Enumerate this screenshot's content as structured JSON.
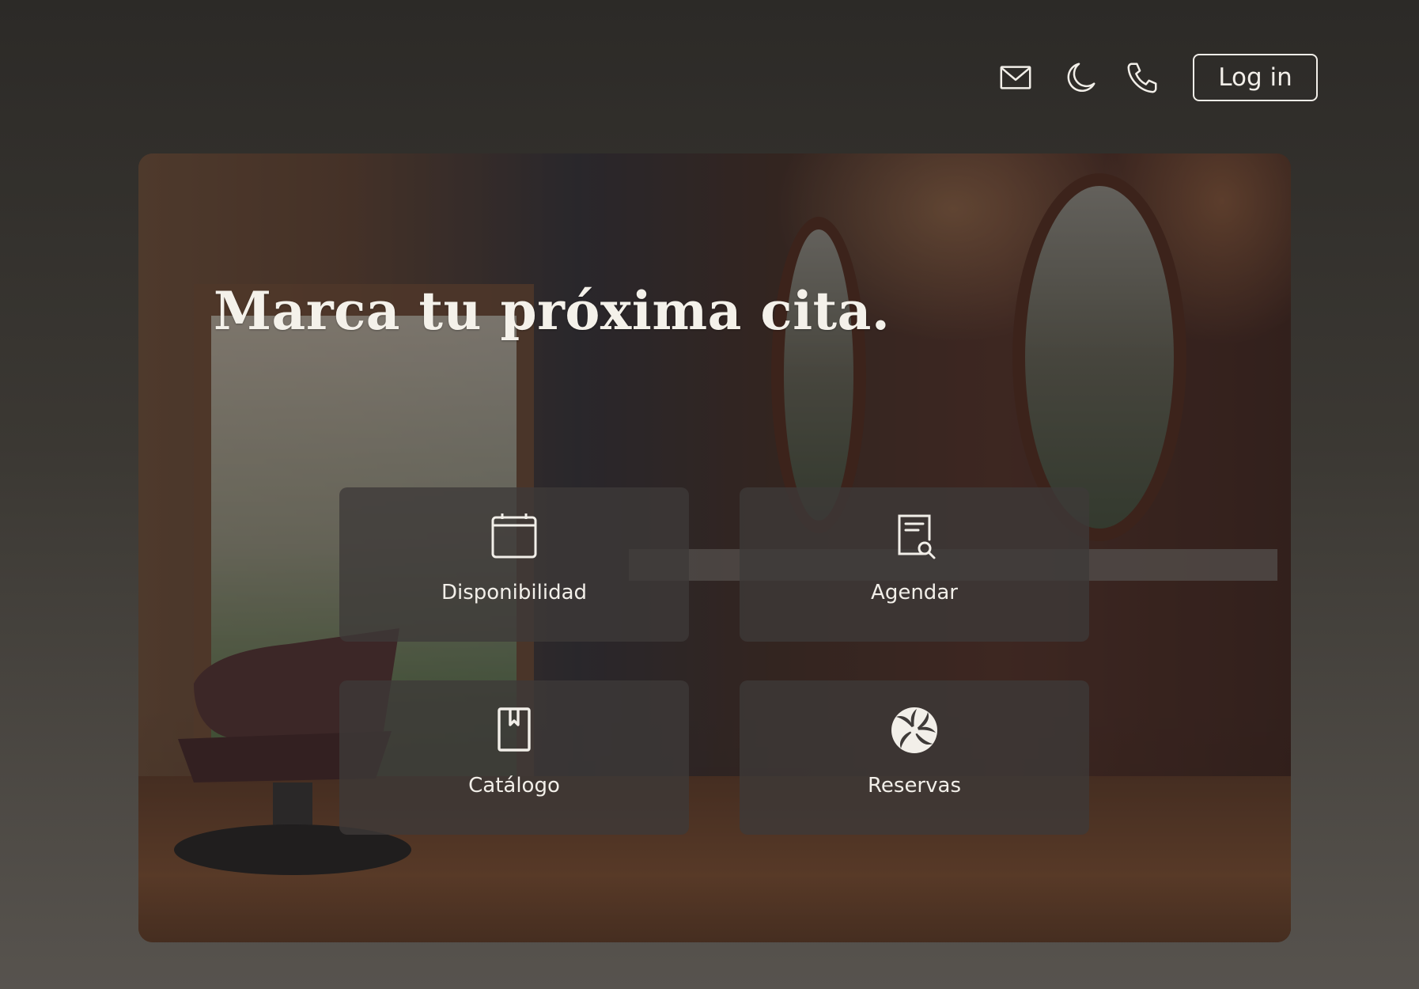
{
  "header": {
    "icons": [
      "mail-icon",
      "moon-icon",
      "phone-icon"
    ],
    "login_label": "Log in"
  },
  "hero": {
    "title": "Marca tu próxima cita.",
    "tiles": [
      {
        "label": "Disponibilidad",
        "icon": "calendar-icon"
      },
      {
        "label": "Agendar",
        "icon": "document-search-icon"
      },
      {
        "label": "Catálogo",
        "icon": "bookmark-book-icon"
      },
      {
        "label": "Reservas",
        "icon": "aperture-swirl-icon"
      }
    ]
  },
  "colors": {
    "text": "#f2efe9",
    "tile_bg": "#3e3a38"
  }
}
